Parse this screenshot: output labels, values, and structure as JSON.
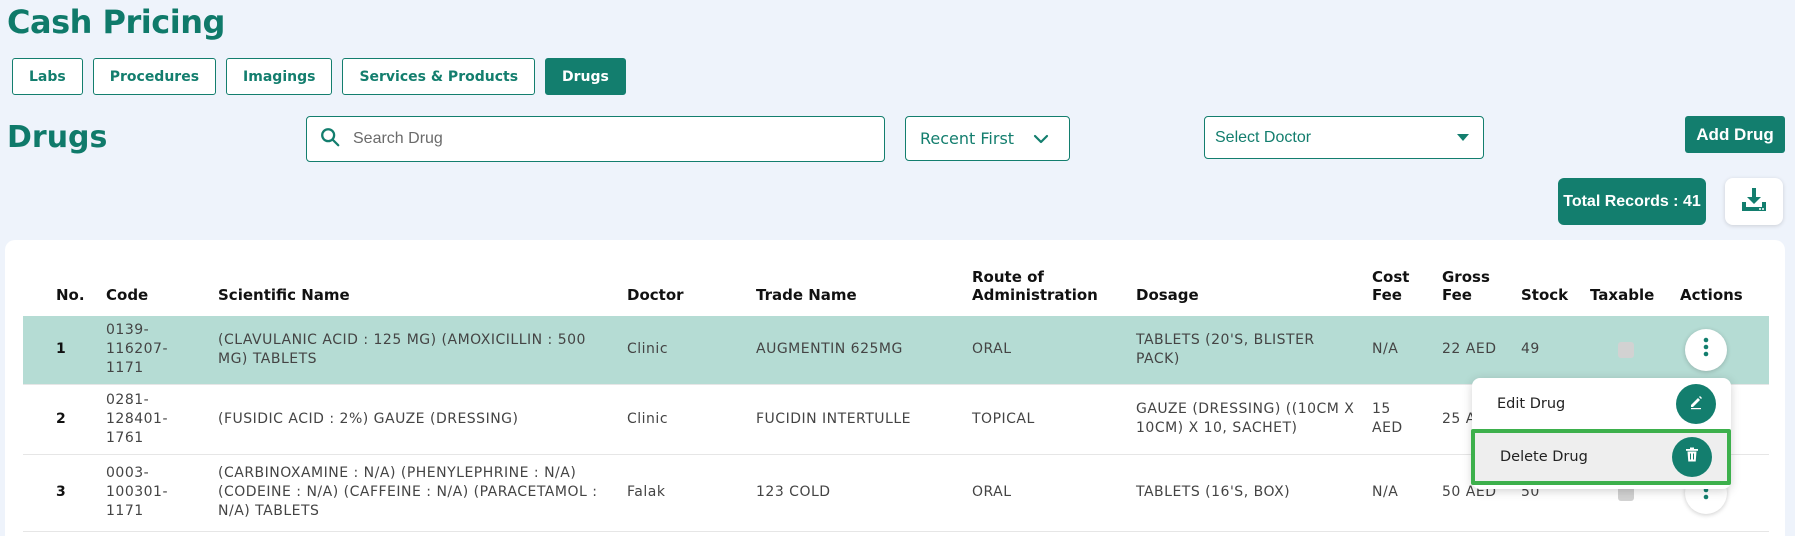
{
  "page": {
    "title": "Cash Pricing"
  },
  "tabs": [
    {
      "label": "Labs",
      "active": false
    },
    {
      "label": "Procedures",
      "active": false
    },
    {
      "label": "Imagings",
      "active": false
    },
    {
      "label": "Services & Products",
      "active": false
    },
    {
      "label": "Drugs",
      "active": true
    }
  ],
  "section": {
    "title": "Drugs"
  },
  "search": {
    "placeholder": "Search Drug",
    "value": ""
  },
  "sort": {
    "selected": "Recent First"
  },
  "doctor_select": {
    "placeholder": "Select Doctor"
  },
  "add_button": {
    "label": "Add Drug"
  },
  "total": {
    "label": "Total Records : 41"
  },
  "table": {
    "headers": {
      "no": "No.",
      "code": "Code",
      "scientific_name": "Scientific Name",
      "doctor": "Doctor",
      "trade_name": "Trade Name",
      "route_line1": "Route of",
      "route_line2": "Administration",
      "dosage": "Dosage",
      "cost_line1": "Cost",
      "cost_line2": "Fee",
      "gross_line1": "Gross",
      "gross_line2": "Fee",
      "stock": "Stock",
      "taxable": "Taxable",
      "actions": "Actions"
    },
    "rows": [
      {
        "no": "1",
        "code": "0139-116207-1171",
        "scientific_name": "(CLAVULANIC ACID : 125 MG) (AMOXICILLIN : 500 MG) TABLETS",
        "doctor": "Clinic",
        "trade_name": "AUGMENTIN 625MG",
        "route": "ORAL",
        "dosage": "TABLETS (20'S, BLISTER PACK)",
        "cost_fee": "N/A",
        "gross_fee": "22 AED",
        "stock": "49",
        "taxable": false
      },
      {
        "no": "2",
        "code": "0281-128401-1761",
        "scientific_name": "(FUSIDIC ACID : 2%) GAUZE (DRESSING)",
        "doctor": "Clinic",
        "trade_name": "FUCIDIN INTERTULLE",
        "route": "TOPICAL",
        "dosage": "GAUZE (DRESSING) ((10CM X 10CM) X 10, SACHET)",
        "cost_fee": "15 AED",
        "gross_fee": "25 A",
        "stock": "",
        "taxable": false
      },
      {
        "no": "3",
        "code": "0003-100301-1171",
        "scientific_name": "(CARBINOXAMINE : N/A) (PHENYLEPHRINE : N/A) (CODEINE : N/A) (CAFFEINE : N/A) (PARACETAMOL : N/A) TABLETS",
        "doctor": "Falak",
        "trade_name": "123 COLD",
        "route": "ORAL",
        "dosage": "TABLETS (16'S, BOX)",
        "cost_fee": "N/A",
        "gross_fee": "50 AED",
        "stock": "50",
        "taxable": false
      }
    ]
  },
  "action_menu": {
    "edit_label": "Edit Drug",
    "delete_label": "Delete Drug"
  },
  "colors": {
    "primary": "#137e6e",
    "selected_row": "#b5dcd4",
    "highlight_border": "#3db04c",
    "background": "#eef3fb"
  },
  "icons": [
    "search-icon",
    "chevron-down-icon",
    "caret-down-icon",
    "download-icon",
    "kebab-icon",
    "pencil-icon",
    "trash-icon"
  ]
}
